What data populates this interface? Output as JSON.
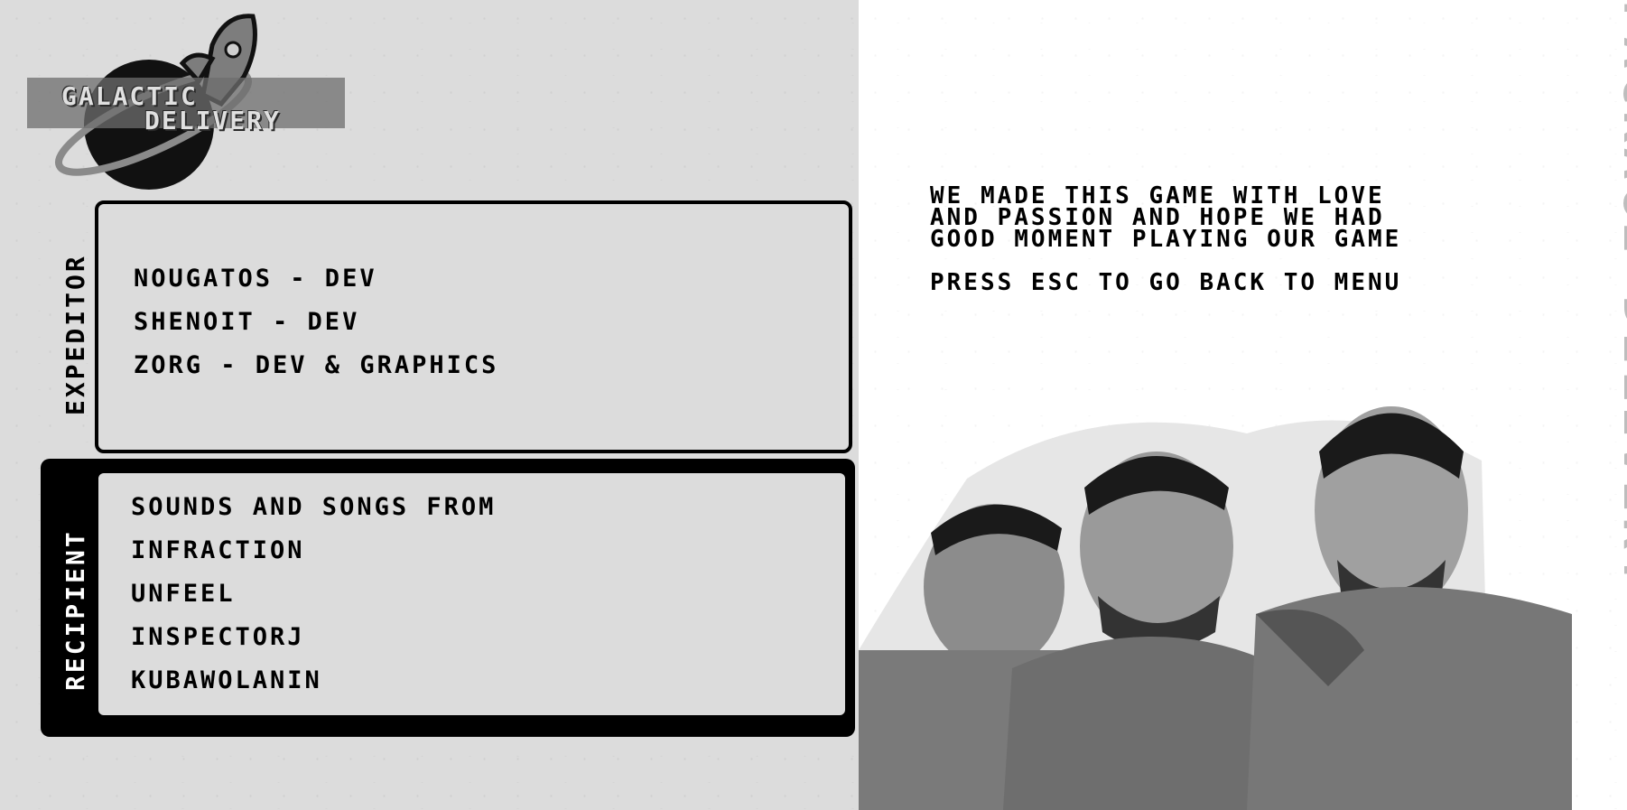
{
  "logo": {
    "line1": "GALACTIC",
    "line2": "DELIVERY",
    "icon": "rocket-planet-icon"
  },
  "expeditor": {
    "label": "EXPEDITOR",
    "lines": [
      "NOUGATOS - DEV",
      "SHENOIT - DEV",
      "ZORG - DEV & GRAPHICS"
    ]
  },
  "recipient": {
    "label": "RECIPIENT",
    "lines": [
      "SOUNDS AND SONGS FROM",
      "INFRACTION",
      "UNFEEL",
      "INSPECTORJ",
      "KUBAWOLANIN"
    ]
  },
  "message": {
    "thanks": "WE MADE THIS GAME WITH LOVE\nAND PASSION AND HOPE WE HAD\nGOOD MOMENT PLAYING OUR GAME",
    "hint": "PRESS ESC TO GO BACK TO MENU"
  },
  "side_title": "PACKAGE DELIVERY",
  "colors": {
    "panel_bg": "#dcdcdc",
    "ink": "#000000",
    "side_title": "#bdbdbd"
  }
}
